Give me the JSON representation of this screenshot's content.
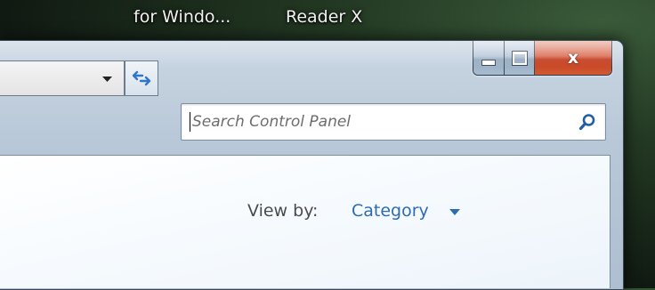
{
  "desktop": {
    "labels": [
      "for Windo...",
      "Reader X"
    ]
  },
  "window": {
    "caption": {
      "minimize_icon": "minimize-icon",
      "maximize_icon": "maximize-icon",
      "close_label": "x"
    },
    "toolbar": {
      "address_dropdown_icon": "chevron-down-icon",
      "refresh_icon": "refresh-arrows-icon"
    },
    "search": {
      "placeholder": "Search Control Panel",
      "value": "",
      "icon": "search-icon"
    },
    "content": {
      "view_by_label": "View by:",
      "view_by_value": "Category",
      "view_by_arrow_icon": "triangle-down-icon"
    }
  },
  "colors": {
    "link": "#2d6bb3",
    "close_red": "#c1381a"
  }
}
